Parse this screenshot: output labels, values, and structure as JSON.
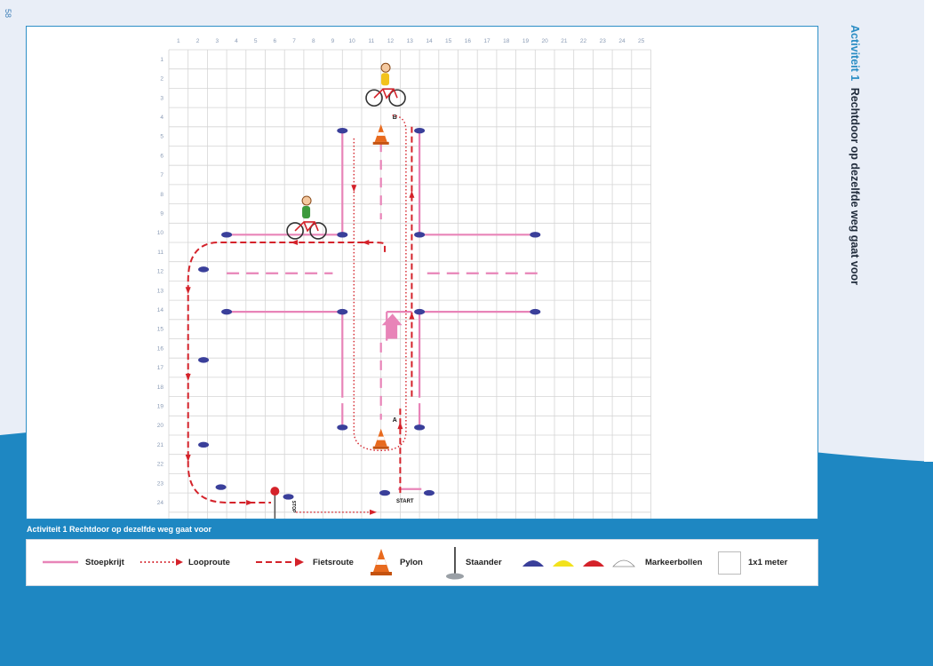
{
  "page_number": "58",
  "side_title": {
    "activity": "Activiteit 1",
    "title": "Rechtdoor op dezelfde weg gaat voor"
  },
  "caption": "Activiteit 1 Rechtdoor op dezelfde weg gaat voor",
  "grid": {
    "col_labels": [
      "1",
      "2",
      "3",
      "4",
      "5",
      "6",
      "7",
      "8",
      "9",
      "10",
      "11",
      "12",
      "13",
      "14",
      "15",
      "16",
      "17",
      "18",
      "19",
      "20",
      "21",
      "22",
      "23",
      "24",
      "25"
    ],
    "row_labels": [
      "1",
      "2",
      "3",
      "4",
      "5",
      "6",
      "7",
      "8",
      "9",
      "10",
      "11",
      "12",
      "13",
      "14",
      "15",
      "16",
      "17",
      "18",
      "19",
      "20",
      "21",
      "22",
      "23",
      "24"
    ]
  },
  "markers": {
    "a": "A",
    "b": "B",
    "start": "START",
    "stop": "STOP"
  },
  "legend": {
    "stoepkrijt": "Stoepkrijt",
    "looproute": "Looproute",
    "fietsroute": "Fietsroute",
    "pylon": "Pylon",
    "staander": "Staander",
    "markeerbollen": "Markeerbollen",
    "meter": "1x1 meter"
  },
  "colors": {
    "chalk": "#e884b8",
    "route": "#d4222a",
    "cone_blue": "#3a3f9a",
    "accent": "#2a8dc4"
  }
}
